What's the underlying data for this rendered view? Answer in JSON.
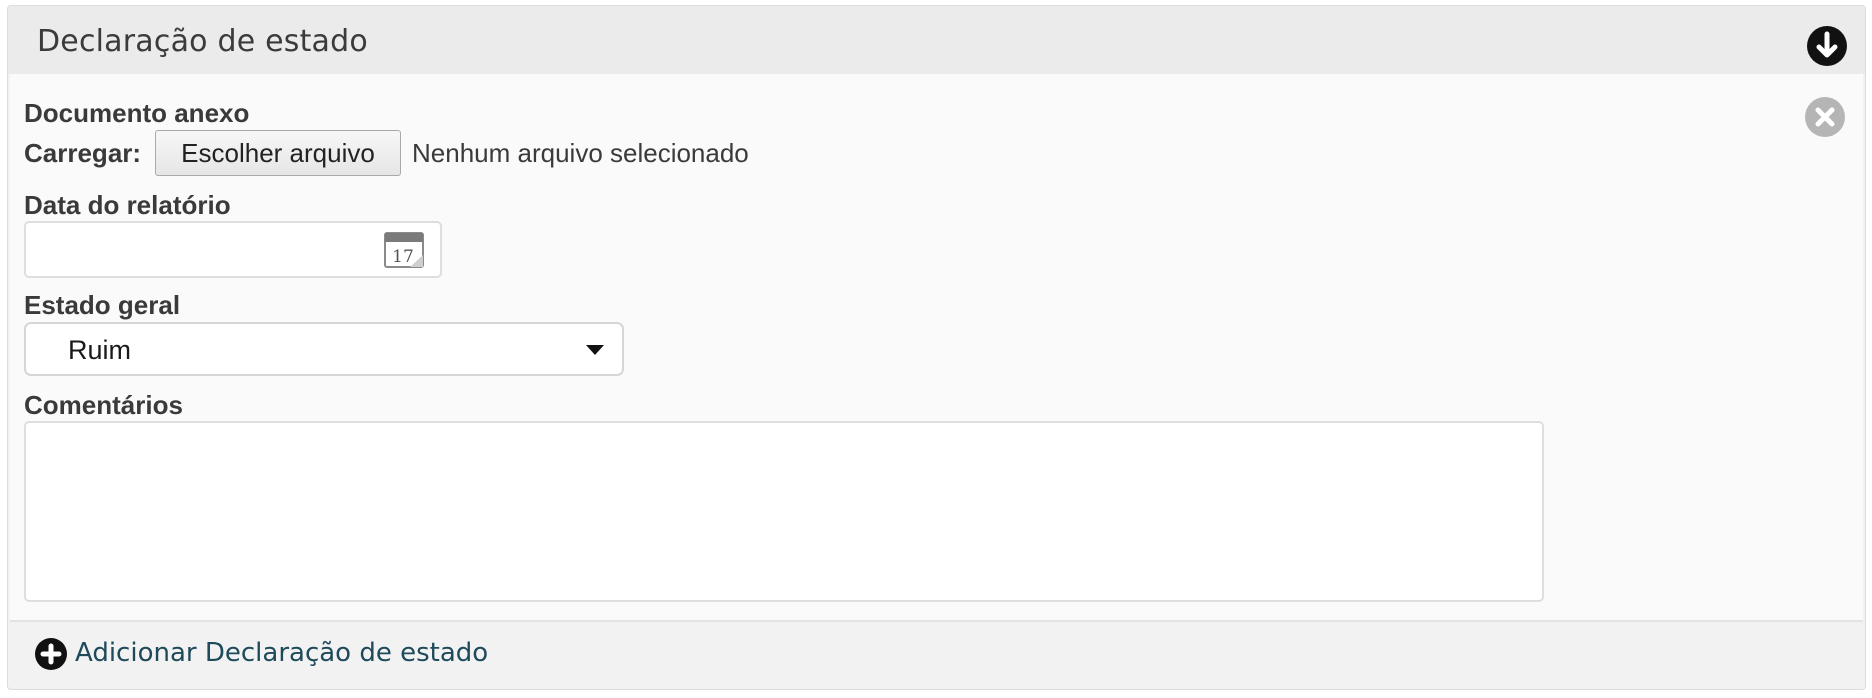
{
  "panel": {
    "title": "Declaração de estado",
    "collapse_icon": "arrow-down-circle-icon"
  },
  "form": {
    "remove_icon": "close-circle-icon",
    "attached_document_label": "Documento anexo",
    "upload_label": "Carregar:",
    "file_button_label": "Escolher arquivo",
    "file_status": "Nenhum arquivo selecionado",
    "report_date_label": "Data do relatório",
    "report_date_value": "",
    "calendar_icon": "calendar-icon",
    "calendar_day": "17",
    "overall_state_label": "Estado geral",
    "overall_state_value": "Ruim",
    "comments_label": "Comentários",
    "comments_value": ""
  },
  "footer": {
    "add_icon": "plus-circle-icon",
    "add_label": "Adicionar Declaração de estado"
  }
}
